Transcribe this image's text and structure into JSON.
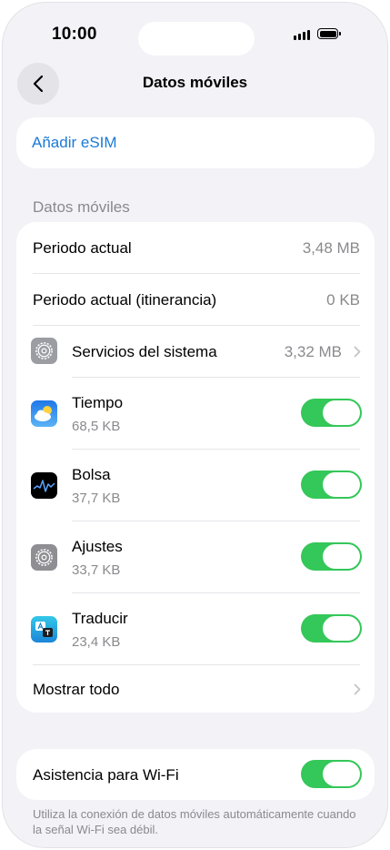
{
  "status_bar": {
    "time": "10:00"
  },
  "nav": {
    "title": "Datos móviles"
  },
  "esim": {
    "label": "Añadir eSIM"
  },
  "section": {
    "header": "Datos móviles"
  },
  "rows": {
    "current_period": {
      "label": "Periodo actual",
      "value": "3,48 MB"
    },
    "roaming_period": {
      "label": "Periodo actual (itinerancia)",
      "value": "0 KB"
    },
    "system_services": {
      "label": "Servicios del sistema",
      "value": "3,32 MB"
    }
  },
  "apps": [
    {
      "name": "Tiempo",
      "size": "68,5 KB",
      "enabled": true,
      "icon": "weather-icon"
    },
    {
      "name": "Bolsa",
      "size": "37,7 KB",
      "enabled": true,
      "icon": "stocks-icon"
    },
    {
      "name": "Ajustes",
      "size": "33,7 KB",
      "enabled": true,
      "icon": "settings-icon"
    },
    {
      "name": "Traducir",
      "size": "23,4 KB",
      "enabled": true,
      "icon": "translate-icon"
    }
  ],
  "show_all": {
    "label": "Mostrar todo"
  },
  "wifi_assist": {
    "label": "Asistencia para Wi-Fi",
    "enabled": true,
    "footnote": "Utiliza la conexión de datos móviles automáticamente cuando la señal Wi-Fi sea débil."
  },
  "colors": {
    "accent": "#1a7ad6",
    "toggle_on": "#34c759",
    "background": "#f2f2f7"
  }
}
